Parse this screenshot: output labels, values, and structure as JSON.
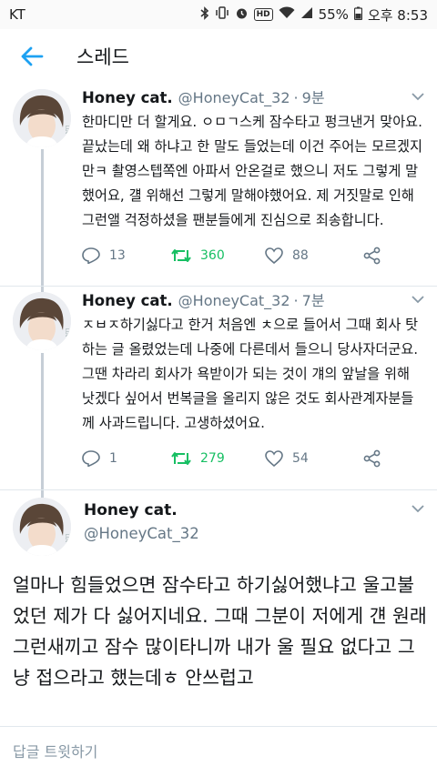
{
  "status_bar": {
    "carrier": "KT",
    "battery": "55%",
    "time": "오후 8:53",
    "icons": [
      "bluetooth-icon",
      "vibrate-icon",
      "alarm-icon",
      "hd-icon",
      "wifi-icon",
      "signal-icon",
      "battery-icon"
    ],
    "hd_label": "HD"
  },
  "header": {
    "title": "스레드",
    "accent_color": "#1da1f2"
  },
  "tweets": [
    {
      "name": "Honey cat.",
      "handle": "@HoneyCat_32",
      "time": "9분",
      "text": "한마디만 더 할게요. ㅇㅁㄱ스케 잠수타고 펑크낸거 맞아요. 끝났는데 왜 하냐고 한 말도 들었는데 이건 주어는 모르겠지만ㅋ 촬영스텝쪽엔 아파서 안온걸로 했으니 저도 그렇게 말했어요, 걜 위해선 그렇게 말해야했어요. 제 거짓말로 인해 그런앨 걱정하셨을 팬분들에게 진심으로 죄송합니다.",
      "replies": "13",
      "retweets": "360",
      "likes": "88"
    },
    {
      "name": "Honey cat.",
      "handle": "@HoneyCat_32",
      "time": "7분",
      "text": "ㅈㅂㅈ하기싫다고 한거 처음엔 ㅊ으로 들어서 그때 회사 탓하는 글 올렸었는데 나중에 다른데서 들으니 당사자더군요. 그땐 차라리 회사가 욕받이가 되는 것이 걔의 앞날을 위해 낫겠다 싶어서 번복글을 올리지 않은 것도 회사관계자분들께 사과드립니다. 고생하셨어요.",
      "replies": "1",
      "retweets": "279",
      "likes": "54"
    }
  ],
  "focused": {
    "name": "Honey cat.",
    "handle": "@HoneyCat_32",
    "text": "얼마나 힘들었으면 잠수타고 하기싫어했냐고 울고불었던 제가 다 싫어지네요. 그때 그분이 저에게 걘 원래 그런새끼고 잠수 많이타니까 내가 울 필요 없다고 그냥 접으라고 했는데ㅎ 안쓰럽고"
  },
  "reply_bar": {
    "placeholder": "답글 트윗하기"
  }
}
